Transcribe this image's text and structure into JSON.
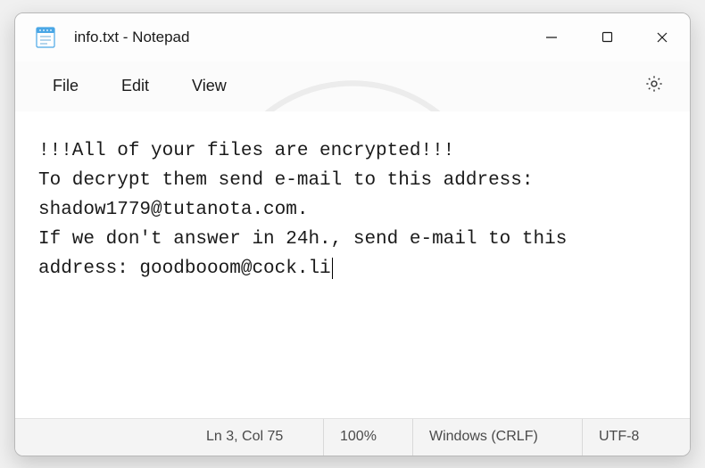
{
  "titlebar": {
    "title": "info.txt - Notepad"
  },
  "menubar": {
    "file": "File",
    "edit": "Edit",
    "view": "View"
  },
  "content": {
    "text": "!!!All of your files are encrypted!!!\nTo decrypt them send e-mail to this address: shadow1779@tutanota.com.\nIf we don't answer in 24h., send e-mail to this address: goodbooom@cock.li"
  },
  "statusbar": {
    "position": "Ln 3, Col 75",
    "zoom": "100%",
    "line_ending": "Windows (CRLF)",
    "encoding": "UTF-8"
  }
}
